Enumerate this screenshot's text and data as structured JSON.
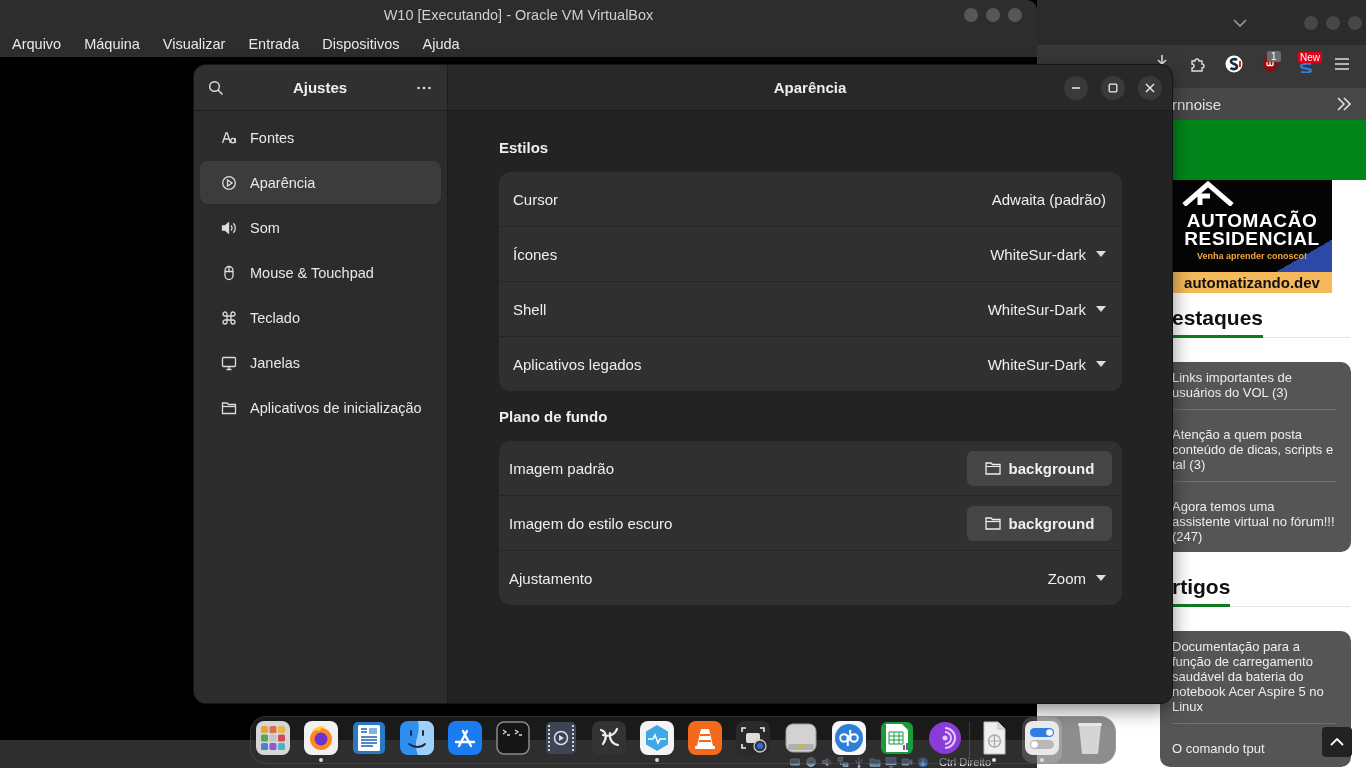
{
  "vbox_window": {
    "title": "W10 [Executando] - Oracle VM VirtualBox",
    "menu": [
      "Arquivo",
      "Máquina",
      "Visualizar",
      "Entrada",
      "Dispositivos",
      "Ajuda"
    ],
    "status_bar": {
      "host_key": "Ctrl Direito"
    }
  },
  "browser": {
    "extension_badges": [
      "1",
      "New"
    ],
    "bookmarks": [
      "rnnoise"
    ],
    "banner": {
      "headline": [
        "AUTOMACÃO",
        "RESIDENCIAL"
      ],
      "tagline": "Venha aprender conosco!",
      "site": "automatizando.dev"
    },
    "sections": [
      {
        "heading": "estaques",
        "items": [
          "Links importantes de usuários do VOL (3)",
          "Atenção a quem posta conteúdo de dicas, scripts e tal (3)",
          "Agora temos uma assistente virtual no fórum!!! (247)"
        ]
      },
      {
        "heading": "rtigos",
        "items": [
          "Documentação para a função de carregamento saudável da bateria do notebook Acer Aspire 5 no Linux",
          "O comando tput"
        ]
      }
    ]
  },
  "settings_window": {
    "sidebar_title": "Ajustes",
    "title": "Aparência",
    "sidebar": [
      {
        "label": "Fontes",
        "selected": false
      },
      {
        "label": "Aparência",
        "selected": true
      },
      {
        "label": "Som",
        "selected": false
      },
      {
        "label": "Mouse & Touchpad",
        "selected": false
      },
      {
        "label": "Teclado",
        "selected": false
      },
      {
        "label": "Janelas",
        "selected": false
      },
      {
        "label": "Aplicativos de inicialização",
        "selected": false
      }
    ],
    "groups": [
      {
        "heading": "Estilos",
        "rows": [
          {
            "label": "Cursor",
            "kind": "value",
            "value": "Adwaita (padrão)"
          },
          {
            "label": "Ícones",
            "kind": "dropdown",
            "value": "WhiteSur-dark"
          },
          {
            "label": "Shell",
            "kind": "dropdown",
            "value": "WhiteSur-Dark"
          },
          {
            "label": "Aplicativos legados",
            "kind": "dropdown",
            "value": "WhiteSur-Dark"
          }
        ]
      },
      {
        "heading": "Plano de fundo",
        "rows": [
          {
            "label": "Imagem padrão",
            "kind": "file",
            "value": "background"
          },
          {
            "label": "Imagem do estilo escuro",
            "kind": "file",
            "value": "background"
          },
          {
            "label": "Ajustamento",
            "kind": "dropdown",
            "value": "Zoom"
          }
        ]
      }
    ]
  },
  "dock": {
    "favorites": [
      {
        "running": false,
        "focused": false
      },
      {
        "running": true,
        "focused": false
      },
      {
        "running": false,
        "focused": false
      },
      {
        "running": false,
        "focused": false
      },
      {
        "running": false,
        "focused": false
      },
      {
        "running": false,
        "focused": false
      },
      {
        "running": false,
        "focused": false
      },
      {
        "running": false,
        "focused": false
      },
      {
        "running": true,
        "focused": false
      },
      {
        "running": false,
        "focused": false
      },
      {
        "running": false,
        "focused": false
      },
      {
        "running": false,
        "focused": false
      },
      {
        "running": false,
        "focused": false
      },
      {
        "running": false,
        "focused": false
      },
      {
        "running": false,
        "focused": false
      }
    ],
    "others": [
      {
        "running": true,
        "focused": false
      },
      {
        "running": true,
        "focused": true
      },
      {
        "running": false,
        "focused": false
      }
    ]
  }
}
